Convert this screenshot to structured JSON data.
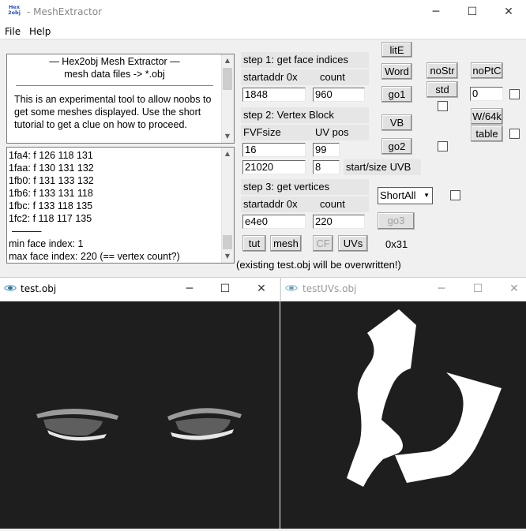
{
  "app": {
    "title": "MeshExtractor",
    "icon_text_top": "Hex",
    "icon_text_bottom": "2obj",
    "menu": [
      "File",
      "Help"
    ]
  },
  "info": {
    "header": "—   Hex2obj Mesh Extractor   —",
    "subheader": "mesh data files -> *.obj",
    "body": "This is an experimental tool to allow noobs to get some meshes displayed. Use the short tutorial to get a clue on how to proceed."
  },
  "face_list": {
    "rows": [
      "1fa4: f  126 118 131",
      "1faa: f  130 131 132",
      "1fb0: f  131 133 132",
      "1fb6: f  133 131 118",
      "1fbc: f  133 118 135",
      "1fc2: f  118 117 135"
    ],
    "divider": "———",
    "min_line": "min face index: 1",
    "max_line": "max face index: 220 (== vertex count?)"
  },
  "step1": {
    "title": "step 1: get face indices",
    "col1": "startaddr 0x",
    "col2": "count",
    "startaddr": "1848",
    "count": "960"
  },
  "step2": {
    "title": "step 2: Vertex Block",
    "col1": "FVFsize",
    "col2": "UV pos",
    "fvfsize": "16",
    "uvpos": "99",
    "uvb_start": "21020",
    "uvb_size": "8",
    "uvb_label": "start/size UVB"
  },
  "step3": {
    "title": "step 3: get vertices",
    "col1": "startaddr 0x",
    "col2": "count",
    "startaddr": "e4e0",
    "count": "220"
  },
  "buttons": {
    "lite": "litE",
    "word": "Word",
    "go1": "go1",
    "vb": "VB",
    "go2": "go2",
    "go3": "go3",
    "nostr": "noStr",
    "std": "std",
    "noptc": "noPtC",
    "w64k": "W/64k",
    "table": "table",
    "tut": "tut",
    "mesh": "mesh",
    "cf": "CF",
    "uvs": "UVs"
  },
  "misc": {
    "noptc_value": "0",
    "dropdown_value": "ShortAll",
    "count_readout": "0x31",
    "warning": "(existing test.obj will be overwritten!)"
  },
  "windows": {
    "mesh_title": "test.obj",
    "uv_title": "testUVs.obj"
  }
}
